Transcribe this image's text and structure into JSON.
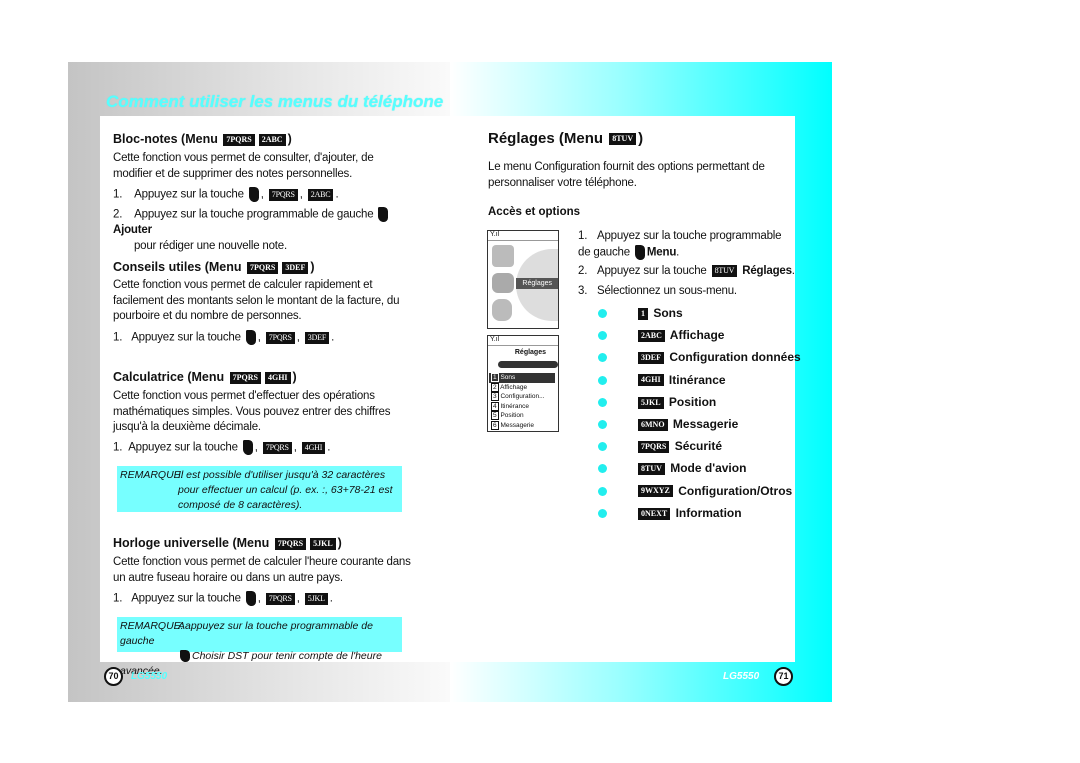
{
  "header": {
    "title": "Comment utiliser les menus du téléphone"
  },
  "left": {
    "bloc": {
      "heading": "Bloc-notes (Menu",
      "keys": [
        "7PQRS",
        "2ABC"
      ],
      "text": "Cette fonction vous permet de consulter, d'ajouter, de modifier et de supprimer des notes personnelles.",
      "step1": "Appuyez sur la touche",
      "step2": "Appuyez sur la touche programmable de gauche",
      "step2_bold": "Ajouter",
      "step2_tail": "pour rédiger une nouvelle note."
    },
    "conseils": {
      "heading": "Conseils utiles (Menu",
      "keys": [
        "7PQRS",
        "3DEF"
      ],
      "text": "Cette fonction vous permet de calculer rapidement et facilement des montants selon le montant de la facture, du pourboire et du nombre de personnes.",
      "step1": "Appuyez sur la touche"
    },
    "calc": {
      "heading": "Calculatrice (Menu",
      "keys": [
        "7PQRS",
        "4GHI"
      ],
      "text": "Cette fonction vous permet d'effectuer des opérations mathématiques simples. Vous pouvez entrer des chiffres jusqu'à la deuxième décimale.",
      "step1": "Appuyez sur la touche"
    },
    "note1": {
      "label": "REMARQUE:",
      "text": "Il est possible d'utiliser jusqu'à 32 caractères pour effectuer un calcul (p. ex. :, 63+78-21 est composé de 8 caractères)."
    },
    "horloge": {
      "heading": "Horloge universelle (Menu",
      "keys": [
        "7PQRS",
        "5JKL"
      ],
      "text": "Cette fonction vous permet de calculer l'heure courante dans un autre fuseau horaire ou dans un autre pays.",
      "step1": "Appuyez sur la touche"
    },
    "note2": {
      "label": "REMARQUE:",
      "line1": "Aappuyez sur la touche programmable de gauche",
      "line2": "Choisir DST pour tenir compte de l'heure avancée."
    },
    "page": "70",
    "model": "LG5550"
  },
  "right": {
    "heading": "Réglages (Menu",
    "key": "8TUV",
    "intro": "Le menu Configuration fournit des options permettant de personnaliser votre téléphone.",
    "sub": "Accès et options",
    "step1": "Appuyez sur la touche programmable de gauche",
    "step1_bold": "Menu",
    "step2": "Appuyez sur la touche",
    "step2_bold": "Réglages",
    "step3": "Sélectionnez un sous-menu.",
    "menu": [
      {
        "key": "1",
        "label": "Sons"
      },
      {
        "key": "2ABC",
        "label": "Affichage"
      },
      {
        "key": "3DEF",
        "label": "Configuration données"
      },
      {
        "key": "4GHI",
        "label": "Itinérance"
      },
      {
        "key": "5JKL",
        "label": "Position"
      },
      {
        "key": "6MNO",
        "label": "Messagerie"
      },
      {
        "key": "7PQRS",
        "label": "Sécurité"
      },
      {
        "key": "8TUV",
        "label": "Mode d'avion"
      },
      {
        "key": "9WXYZ",
        "label": "Configuration/Otros"
      },
      {
        "key": "0NEXT",
        "label": "Information"
      }
    ],
    "screen1": {
      "label": "Réglages"
    },
    "screen2": {
      "title": "Réglages",
      "items": [
        "Sons",
        "Affichage",
        "Configuration...",
        "Itinérance",
        "Position",
        "Messagerie"
      ]
    },
    "page": "71",
    "model": "LG5550"
  }
}
